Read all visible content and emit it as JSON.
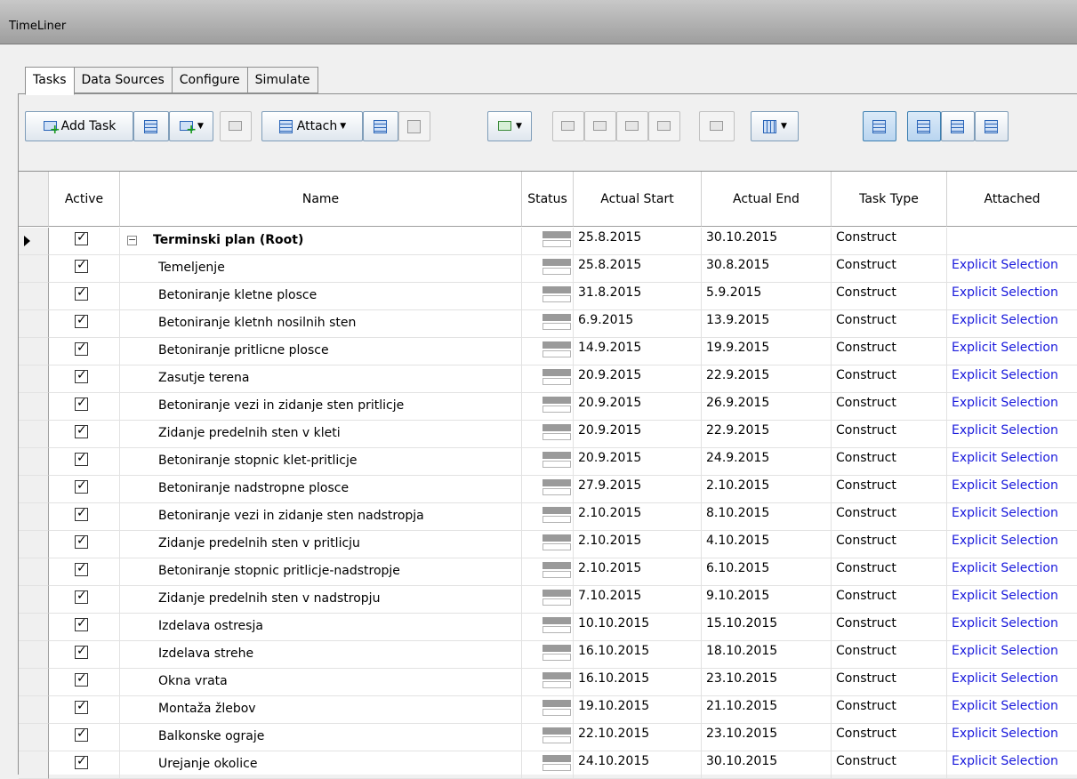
{
  "window": {
    "title": "TimeLiner"
  },
  "tabs": [
    "Tasks",
    "Data Sources",
    "Configure",
    "Simulate"
  ],
  "toolbar": {
    "add_task": "Add Task",
    "attach": "Attach"
  },
  "columns": [
    "Active",
    "Name",
    "Status",
    "Actual Start",
    "Actual End",
    "Task Type",
    "Attached"
  ],
  "rows": [
    {
      "name": "Terminski plan (Root)",
      "start": "25.8.2015",
      "end": "30.10.2015",
      "type": "Construct",
      "attached": "",
      "root": true
    },
    {
      "name": "Temeljenje",
      "start": "25.8.2015",
      "end": "30.8.2015",
      "type": "Construct",
      "attached": "Explicit Selection"
    },
    {
      "name": "Betoniranje kletne plosce",
      "start": "31.8.2015",
      "end": "5.9.2015",
      "type": "Construct",
      "attached": "Explicit Selection"
    },
    {
      "name": "Betoniranje kletnh nosilnih sten",
      "start": "6.9.2015",
      "end": "13.9.2015",
      "type": "Construct",
      "attached": "Explicit Selection"
    },
    {
      "name": "Betoniranje pritlicne plosce",
      "start": "14.9.2015",
      "end": "19.9.2015",
      "type": "Construct",
      "attached": "Explicit Selection"
    },
    {
      "name": "Zasutje terena",
      "start": "20.9.2015",
      "end": "22.9.2015",
      "type": "Construct",
      "attached": "Explicit Selection"
    },
    {
      "name": "Betoniranje vezi in zidanje sten pritlicje",
      "start": "20.9.2015",
      "end": "26.9.2015",
      "type": "Construct",
      "attached": "Explicit Selection"
    },
    {
      "name": "Zidanje predelnih sten v kleti",
      "start": "20.9.2015",
      "end": "22.9.2015",
      "type": "Construct",
      "attached": "Explicit Selection"
    },
    {
      "name": "Betoniranje stopnic klet-pritlicje",
      "start": "20.9.2015",
      "end": "24.9.2015",
      "type": "Construct",
      "attached": "Explicit Selection"
    },
    {
      "name": "Betoniranje nadstropne plosce",
      "start": "27.9.2015",
      "end": "2.10.2015",
      "type": "Construct",
      "attached": "Explicit Selection"
    },
    {
      "name": "Betoniranje vezi in zidanje sten nadstropja",
      "start": "2.10.2015",
      "end": "8.10.2015",
      "type": "Construct",
      "attached": "Explicit Selection"
    },
    {
      "name": "Zidanje predelnih sten v pritlicju",
      "start": "2.10.2015",
      "end": "4.10.2015",
      "type": "Construct",
      "attached": "Explicit Selection"
    },
    {
      "name": "Betoniranje stopnic pritlicje-nadstropje",
      "start": "2.10.2015",
      "end": "6.10.2015",
      "type": "Construct",
      "attached": "Explicit Selection"
    },
    {
      "name": "Zidanje predelnih sten v nadstropju",
      "start": "7.10.2015",
      "end": "9.10.2015",
      "type": "Construct",
      "attached": "Explicit Selection"
    },
    {
      "name": "Izdelava ostresja",
      "start": "10.10.2015",
      "end": "15.10.2015",
      "type": "Construct",
      "attached": "Explicit Selection"
    },
    {
      "name": "Izdelava strehe",
      "start": "16.10.2015",
      "end": "18.10.2015",
      "type": "Construct",
      "attached": "Explicit Selection"
    },
    {
      "name": "Okna vrata",
      "start": "16.10.2015",
      "end": "23.10.2015",
      "type": "Construct",
      "attached": "Explicit Selection"
    },
    {
      "name": "Montaža žlebov",
      "start": "19.10.2015",
      "end": "21.10.2015",
      "type": "Construct",
      "attached": "Explicit Selection"
    },
    {
      "name": "Balkonske ograje",
      "start": "22.10.2015",
      "end": "23.10.2015",
      "type": "Construct",
      "attached": "Explicit Selection"
    },
    {
      "name": "Urejanje okolice",
      "start": "24.10.2015",
      "end": "30.10.2015",
      "type": "Construct",
      "attached": "Explicit Selection"
    }
  ],
  "colors": {
    "link": "#1a1adc",
    "accent": "#2a65b8"
  }
}
